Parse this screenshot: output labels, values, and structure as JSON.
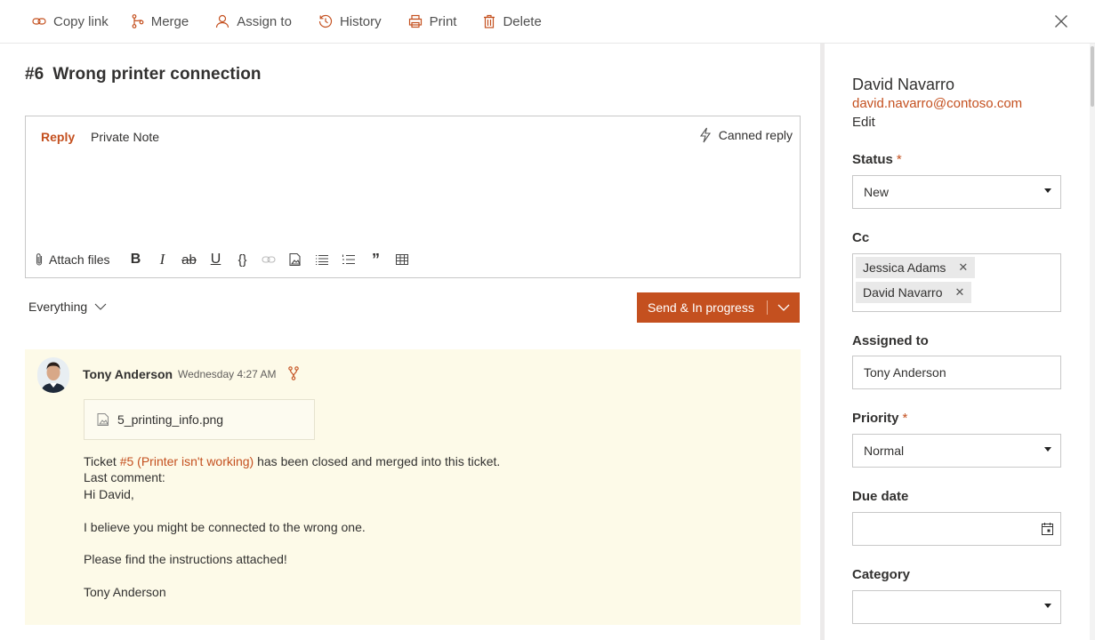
{
  "toolbar": {
    "copy_link": "Copy link",
    "merge": "Merge",
    "assign_to": "Assign to",
    "history": "History",
    "print": "Print",
    "delete": "Delete"
  },
  "ticket": {
    "number": "#6",
    "title": "Wrong printer connection"
  },
  "editor": {
    "tab_reply": "Reply",
    "tab_private": "Private Note",
    "canned_reply": "Canned reply",
    "attach_files": "Attach files"
  },
  "filter": {
    "selected": "Everything"
  },
  "send_button": {
    "label": "Send & In progress"
  },
  "message": {
    "author": "Tony Anderson",
    "time": "Wednesday 4:27 AM",
    "attachment": "5_printing_info.png",
    "line1_pre": "Ticket ",
    "line1_link": "#5 (Printer isn't working)",
    "line1_post": " has been closed and merged into this ticket.",
    "line2": "Last comment:",
    "line3": "Hi David,",
    "line5": "I believe you might be connected to the wrong one.",
    "line7": "Please find the instructions attached!",
    "line9": "Tony Anderson"
  },
  "contact": {
    "name": "David Navarro",
    "email": "david.navarro@contoso.com",
    "edit": "Edit"
  },
  "fields": {
    "status_label": "Status",
    "status_value": "New",
    "cc_label": "Cc",
    "cc": [
      "Jessica Adams",
      "David Navarro"
    ],
    "assigned_label": "Assigned to",
    "assigned_value": "Tony Anderson",
    "priority_label": "Priority",
    "priority_value": "Normal",
    "due_label": "Due date",
    "due_value": "",
    "category_label": "Category",
    "category_value": "",
    "required_mark": "*"
  },
  "colors": {
    "accent": "#c4501f",
    "message_bg": "#fdfae8"
  }
}
